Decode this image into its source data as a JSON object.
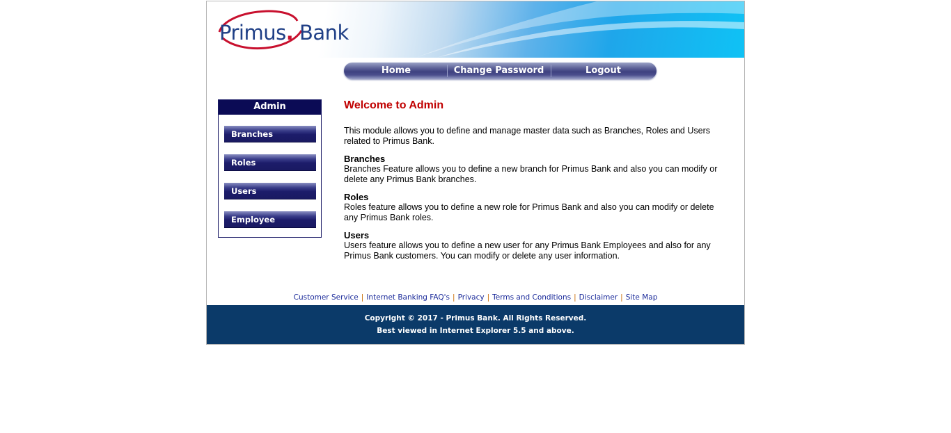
{
  "brand": {
    "logo_name": "Primus",
    "logo_dot": ".",
    "logo_suffix": " Bank",
    "colors": {
      "navy": "#0b0b55",
      "footer": "#0b3a69",
      "accent_red": "#c00000"
    }
  },
  "topnav": {
    "home": "Home",
    "change_password": "Change Password",
    "logout": "Logout"
  },
  "sidebar": {
    "title": "Admin",
    "items": [
      {
        "label": "Branches"
      },
      {
        "label": "Roles"
      },
      {
        "label": "Users"
      },
      {
        "label": "Employee"
      }
    ]
  },
  "content": {
    "heading": "Welcome to Admin",
    "intro": "This module allows you to define and manage master data such as Branches, Roles and Users related to Primus Bank.",
    "sections": [
      {
        "title": "Branches",
        "text": "Branches Feature allows you to define a new branch for Primus Bank and also you can modify or delete any Primus Bank branches."
      },
      {
        "title": "Roles",
        "text": "Roles feature allows you to define a new role for Primus Bank and also you can modify or delete any Primus Bank roles."
      },
      {
        "title": "Users",
        "text": "Users feature allows you to define a new user for any Primus Bank Employees and also for any Primus Bank customers. You can modify or delete any user information."
      }
    ]
  },
  "footer_links": {
    "customer_service": "Customer Service",
    "faq": "Internet Banking FAQ's",
    "privacy": "Privacy",
    "terms": "Terms and Conditions",
    "disclaimer": "Disclaimer",
    "site_map": "Site Map",
    "separator": "|"
  },
  "footer": {
    "copyright": "Copyright © 2017 - Primus Bank. All Rights Reserved.",
    "best_viewed": "Best viewed in Internet Explorer 5.5 and above."
  }
}
